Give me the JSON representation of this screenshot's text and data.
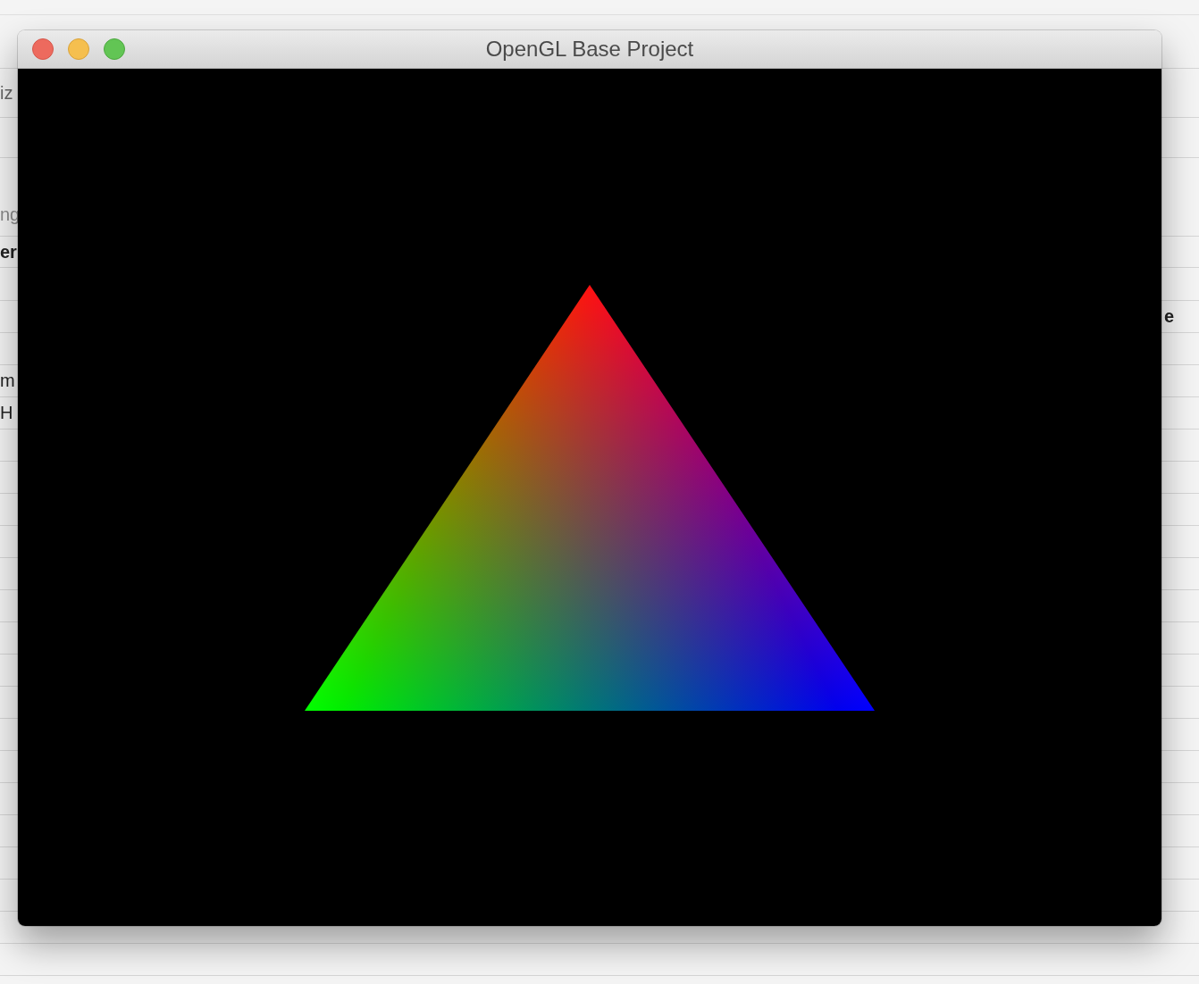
{
  "window": {
    "title": "OpenGL Base Project"
  },
  "left_texts": [
    {
      "text": "iz",
      "kind": "muted"
    },
    {
      "text": "ng",
      "kind": "faint"
    },
    {
      "text": "er",
      "kind": "bold"
    },
    {
      "text": "m",
      "kind": "normal"
    },
    {
      "text": "H",
      "kind": "normal"
    }
  ],
  "right_texts": [
    {
      "text": "e",
      "kind": "bold"
    }
  ]
}
